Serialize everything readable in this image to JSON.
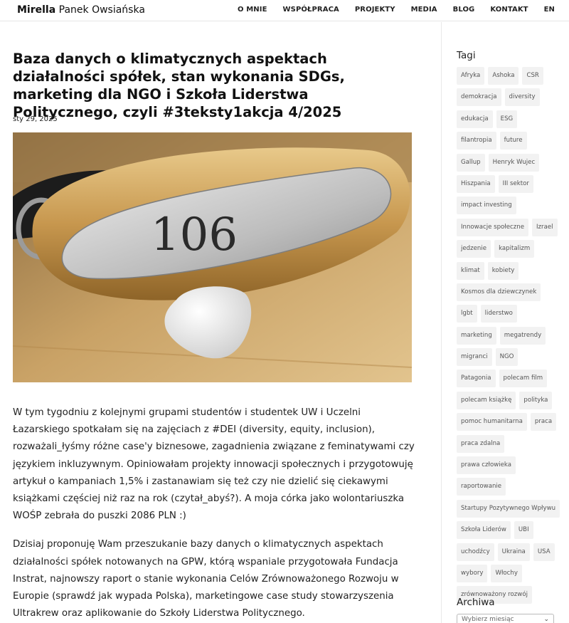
{
  "header": {
    "logo_first": "Mirella",
    "logo_rest": " Panek Owsiańska",
    "nav": [
      "O MNIE",
      "WSPÓŁPRACA",
      "PROJEKTY",
      "MEDIA",
      "BLOG",
      "KONTAKT",
      "EN"
    ]
  },
  "post": {
    "title": "Baza danych o klimatycznych aspektach działalności spółek, stan wykonania SDGs, marketing dla NGO i Szkoła Liderstwa Politycznego, czyli #3teksty1akcja 4/2025",
    "date": "sty 29, 2025",
    "image_number": "106",
    "paragraphs": [
      "W tym tygodniu z kolejnymi grupami studentów i studentek UW i Uczelni Łazarskiego spotkałam się na zajęciach z #DEI (diversity, equity, inclusion), rozważali_łyśmy różne case'y biznesowe, zagadnienia związane z feminatywami czy językiem inkluzywnym. Opiniowałam projekty innowacji społecznych i przygotowuję artykuł o kampaniach 1,5% i zastanawiam się też czy nie dzielić się ciekawymi książkami częściej niż raz na rok (czytał_abyś?). A moja córka jako wolontariuszka WOŚP zebrała do puszki 2086 PLN :)",
      "Dzisiaj proponuję Wam przeszukanie bazy danych o klimatycznych aspektach działalności spółek notowanych na GPW, którą wspaniale przygotowała Fundacja Instrat, najnowszy raport o stanie wykonania Celów Zrównoważonego Rozwoju w Europie (sprawdź jak wypada Polska), marketingowe case study stowarzyszenia Ultrakrew oraz aplikowanie do Szkoły Liderstwa Politycznego."
    ]
  },
  "sidebar": {
    "tags_title": "Tagi",
    "tags": [
      "Afryka",
      "Ashoka",
      "CSR",
      "demokracja",
      "diversity",
      "edukacja",
      "ESG",
      "filantropia",
      "future",
      "Gallup",
      "Henryk Wujec",
      "Hiszpania",
      "III sektor",
      "impact investing",
      "Innowacje społeczne",
      "Izrael",
      "jedzenie",
      "kapitalizm",
      "klimat",
      "kobiety",
      "Kosmos dla dziewczynek",
      "lgbt",
      "liderstwo",
      "marketing",
      "megatrendy",
      "migranci",
      "NGO",
      "Patagonia",
      "polecam film",
      "polecam książkę",
      "polityka",
      "pomoc humanitarna",
      "praca",
      "praca zdalna",
      "prawa człowieka",
      "raportowanie",
      "Startupy Pozytywnego Wpływu",
      "Szkoła Liderów",
      "UBI",
      "uchodźcy",
      "Ukraina",
      "USA",
      "wybory",
      "Włochy",
      "zrównoważony rozwój"
    ],
    "archive_title": "Archiwa",
    "archive_placeholder": "Wybierz miesiąc"
  }
}
